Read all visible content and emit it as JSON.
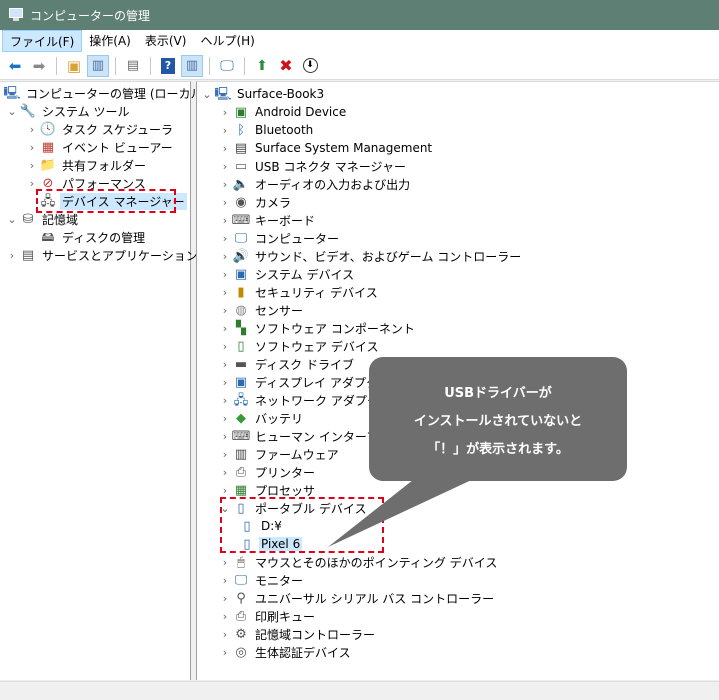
{
  "window": {
    "title": "コンピューターの管理"
  },
  "menu": [
    {
      "label": "ファイル(F)"
    },
    {
      "label": "操作(A)"
    },
    {
      "label": "表示(V)"
    },
    {
      "label": "ヘルプ(H)"
    }
  ],
  "left_tree": {
    "root": "コンピューターの管理 (ローカル)",
    "system_tools": "システム ツール",
    "task_scheduler": "タスク スケジューラ",
    "event_viewer": "イベント ビューアー",
    "shared_folders": "共有フォルダー",
    "performance": "パフォーマンス",
    "device_manager": "デバイス マネージャー",
    "storage": "記憶域",
    "disk_management": "ディスクの管理",
    "services_apps": "サービスとアプリケーション"
  },
  "device_tree": {
    "root": "Surface-Book3",
    "categories": [
      "Android Device",
      "Bluetooth",
      "Surface System Management",
      "USB コネクタ マネージャー",
      "オーディオの入力および出力",
      "カメラ",
      "キーボード",
      "コンピューター",
      "サウンド、ビデオ、およびゲーム コントローラー",
      "システム デバイス",
      "セキュリティ デバイス",
      "センサー",
      "ソフトウェア コンポーネント",
      "ソフトウェア デバイス",
      "ディスク ドライブ",
      "ディスプレイ アダプター",
      "ネットワーク アダプター",
      "バッテリ",
      "ヒューマン インターフェイス デバイス",
      "ファームウェア",
      "プリンター",
      "プロセッサ"
    ],
    "portable": "ポータブル デバイス",
    "portable_children": [
      "D:¥",
      "Pixel 6"
    ],
    "categories_after": [
      "マウスとそのほかのポインティング デバイス",
      "モニター",
      "ユニバーサル シリアル バス コントローラー",
      "印刷キュー",
      "記憶域コントローラー",
      "生体認証デバイス"
    ]
  },
  "callout": {
    "line1": "USBドライバーが",
    "line2": "インストールされていないと",
    "line3": "「！」が表示されます。"
  },
  "icons": {
    "categories": [
      "android-device-icon",
      "bluetooth-icon",
      "system-management-icon",
      "usb-connector-icon",
      "audio-icon",
      "camera-icon",
      "keyboard-icon",
      "computer-icon",
      "sound-icon",
      "system-device-icon",
      "security-icon",
      "sensor-icon",
      "software-component-icon",
      "software-device-icon",
      "disk-drive-icon",
      "display-adapter-icon",
      "network-adapter-icon",
      "battery-icon",
      "hid-icon",
      "firmware-icon",
      "printer-icon",
      "processor-icon"
    ],
    "categories_after": [
      "mouse-icon",
      "monitor-icon",
      "usb-controller-icon",
      "print-queue-icon",
      "storage-controller-icon",
      "biometric-icon"
    ]
  },
  "colors": {
    "titlebar": "#5d7f74",
    "selection": "#cce8ff",
    "callout": "#6e6e6e",
    "highlight_dash": "#e0001a"
  }
}
